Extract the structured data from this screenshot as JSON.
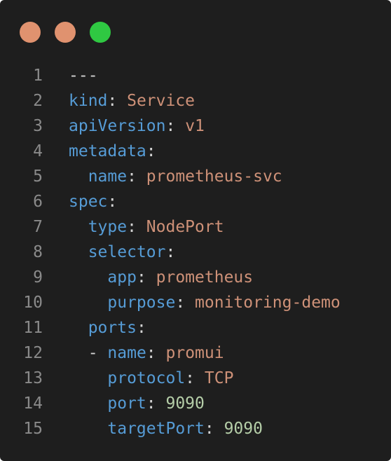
{
  "window": {
    "buttons": {
      "close_color": "#e0926f",
      "minimize_color": "#e0926f",
      "zoom_color": "#2fc842"
    }
  },
  "editor": {
    "language": "yaml",
    "colors": {
      "background": "#1e1e1e",
      "key": "#569cd6",
      "string": "#ce9178",
      "number": "#b5cea8",
      "line_number": "#8a8a8a"
    },
    "lines": [
      {
        "number": "1",
        "indent": "",
        "dash": "",
        "key": "---",
        "sep": "",
        "value": "",
        "value_type": "plain"
      },
      {
        "number": "2",
        "indent": "",
        "dash": "",
        "key": "kind",
        "sep": ": ",
        "value": "Service",
        "value_type": "string"
      },
      {
        "number": "3",
        "indent": "",
        "dash": "",
        "key": "apiVersion",
        "sep": ": ",
        "value": "v1",
        "value_type": "string"
      },
      {
        "number": "4",
        "indent": "",
        "dash": "",
        "key": "metadata",
        "sep": ":",
        "value": "",
        "value_type": "plain"
      },
      {
        "number": "5",
        "indent": "  ",
        "dash": "",
        "key": "name",
        "sep": ": ",
        "value": "prometheus-svc",
        "value_type": "string"
      },
      {
        "number": "6",
        "indent": "",
        "dash": "",
        "key": "spec",
        "sep": ":",
        "value": "",
        "value_type": "plain"
      },
      {
        "number": "7",
        "indent": "  ",
        "dash": "",
        "key": "type",
        "sep": ": ",
        "value": "NodePort",
        "value_type": "string"
      },
      {
        "number": "8",
        "indent": "  ",
        "dash": "",
        "key": "selector",
        "sep": ":",
        "value": "",
        "value_type": "plain"
      },
      {
        "number": "9",
        "indent": "    ",
        "dash": "",
        "key": "app",
        "sep": ": ",
        "value": "prometheus",
        "value_type": "string"
      },
      {
        "number": "10",
        "indent": "    ",
        "dash": "",
        "key": "purpose",
        "sep": ": ",
        "value": "monitoring-demo",
        "value_type": "string"
      },
      {
        "number": "11",
        "indent": "  ",
        "dash": "",
        "key": "ports",
        "sep": ":",
        "value": "",
        "value_type": "plain"
      },
      {
        "number": "12",
        "indent": "  ",
        "dash": "- ",
        "key": "name",
        "sep": ": ",
        "value": "promui",
        "value_type": "string"
      },
      {
        "number": "13",
        "indent": "    ",
        "dash": "",
        "key": "protocol",
        "sep": ": ",
        "value": "TCP",
        "value_type": "string"
      },
      {
        "number": "14",
        "indent": "    ",
        "dash": "",
        "key": "port",
        "sep": ": ",
        "value": "9090",
        "value_type": "number"
      },
      {
        "number": "15",
        "indent": "    ",
        "dash": "",
        "key": "targetPort",
        "sep": ": ",
        "value": "9090",
        "value_type": "number"
      }
    ]
  }
}
